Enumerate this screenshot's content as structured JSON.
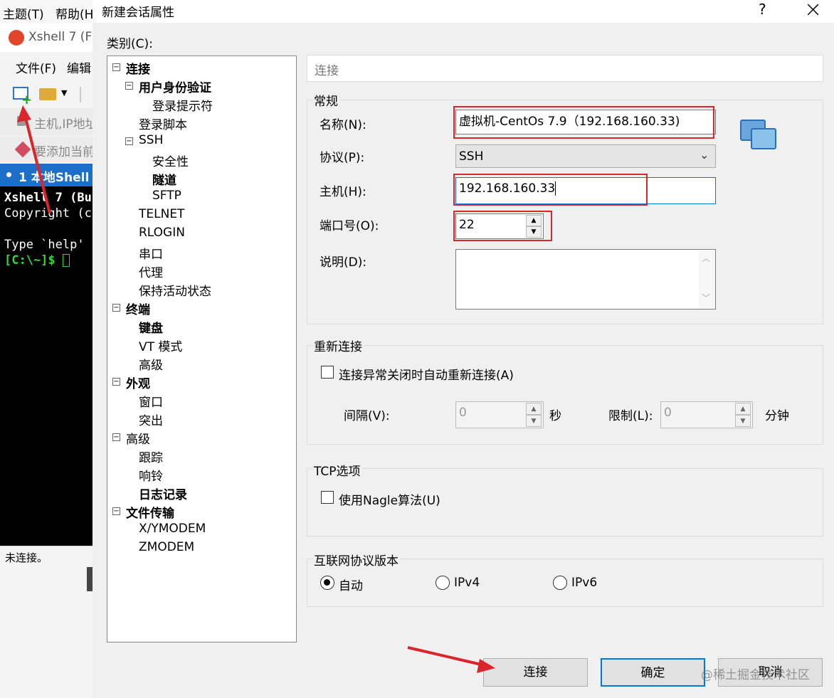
{
  "background_app": {
    "menubar": [
      "主题(T)",
      "帮助(H"
    ],
    "title": "Xshell 7 (F",
    "menu": [
      "文件(F)",
      "编辑"
    ],
    "address_placeholder": "主机,IP地址",
    "hint": "要添加当前",
    "tab_label": "1 本地Shell",
    "terminal_lines": [
      "Xshell 7 (Bu",
      "Copyright (c",
      "",
      "Type `help'",
      "[C:\\~]$ "
    ],
    "status": "未连接。",
    "colors": {
      "tab": "#1c6ec9",
      "prompt": "#33d433"
    }
  },
  "dialog": {
    "title": "新建会话属性",
    "help_glyph": "?",
    "close_glyph": "×",
    "category_label": "类别(C):",
    "tree": [
      {
        "label": "连接",
        "bold": true,
        "level": 0,
        "toggle": "−"
      },
      {
        "label": "用户身份验证",
        "bold": true,
        "level": 1,
        "toggle": "−"
      },
      {
        "label": "登录提示符",
        "bold": false,
        "level": 2
      },
      {
        "label": "登录脚本",
        "bold": false,
        "level": 1
      },
      {
        "label": "SSH",
        "bold": false,
        "level": 1,
        "toggle": "−"
      },
      {
        "label": "安全性",
        "bold": false,
        "level": 2
      },
      {
        "label": "隧道",
        "bold": true,
        "level": 2
      },
      {
        "label": "SFTP",
        "bold": false,
        "level": 2
      },
      {
        "label": "TELNET",
        "bold": false,
        "level": 1
      },
      {
        "label": "RLOGIN",
        "bold": false,
        "level": 1
      },
      {
        "label": "串口",
        "bold": false,
        "level": 1
      },
      {
        "label": "代理",
        "bold": false,
        "level": 1
      },
      {
        "label": "保持活动状态",
        "bold": false,
        "level": 1
      },
      {
        "label": "终端",
        "bold": true,
        "level": 0,
        "toggle": "−"
      },
      {
        "label": "键盘",
        "bold": true,
        "level": 1
      },
      {
        "label": "VT 模式",
        "bold": false,
        "level": 1
      },
      {
        "label": "高级",
        "bold": false,
        "level": 1
      },
      {
        "label": "外观",
        "bold": true,
        "level": 0,
        "toggle": "−"
      },
      {
        "label": "窗口",
        "bold": false,
        "level": 1
      },
      {
        "label": "突出",
        "bold": false,
        "level": 1
      },
      {
        "label": "高级",
        "bold": false,
        "level": 0,
        "toggle": "−"
      },
      {
        "label": "跟踪",
        "bold": false,
        "level": 1
      },
      {
        "label": "响铃",
        "bold": false,
        "level": 1
      },
      {
        "label": "日志记录",
        "bold": true,
        "level": 1
      },
      {
        "label": "文件传输",
        "bold": true,
        "level": 0,
        "toggle": "−"
      },
      {
        "label": "X/YMODEM",
        "bold": false,
        "level": 1
      },
      {
        "label": "ZMODEM",
        "bold": false,
        "level": 1
      }
    ],
    "panel_header": "连接",
    "general": {
      "legend": "常规",
      "name_label": "名称(N):",
      "name_value": "虚拟机-CentOs 7.9（192.168.160.33)",
      "protocol_label": "协议(P):",
      "protocol_value": "SSH",
      "host_label": "主机(H):",
      "host_value": "192.168.160.33",
      "port_label": "端口号(O):",
      "port_value": "22",
      "desc_label": "说明(D):",
      "desc_value": ""
    },
    "reconnect": {
      "legend": "重新连接",
      "auto_label": "连接异常关闭时自动重新连接(A)",
      "interval_label": "间隔(V):",
      "interval_value": "0",
      "interval_unit": "秒",
      "limit_label": "限制(L):",
      "limit_value": "0",
      "limit_unit": "分钟"
    },
    "tcp": {
      "legend": "TCP选项",
      "nagle_label": "使用Nagle算法(U)"
    },
    "ipver": {
      "legend": "互联网协议版本",
      "options": [
        "自动",
        "IPv4",
        "IPv6"
      ],
      "selected": "自动"
    },
    "buttons": {
      "connect": "连接",
      "ok": "确定",
      "cancel": "取消"
    },
    "watermark": "@稀土掘金技术社区",
    "colors": {
      "highlight": "#d9262c",
      "accent": "#0078d7"
    }
  }
}
